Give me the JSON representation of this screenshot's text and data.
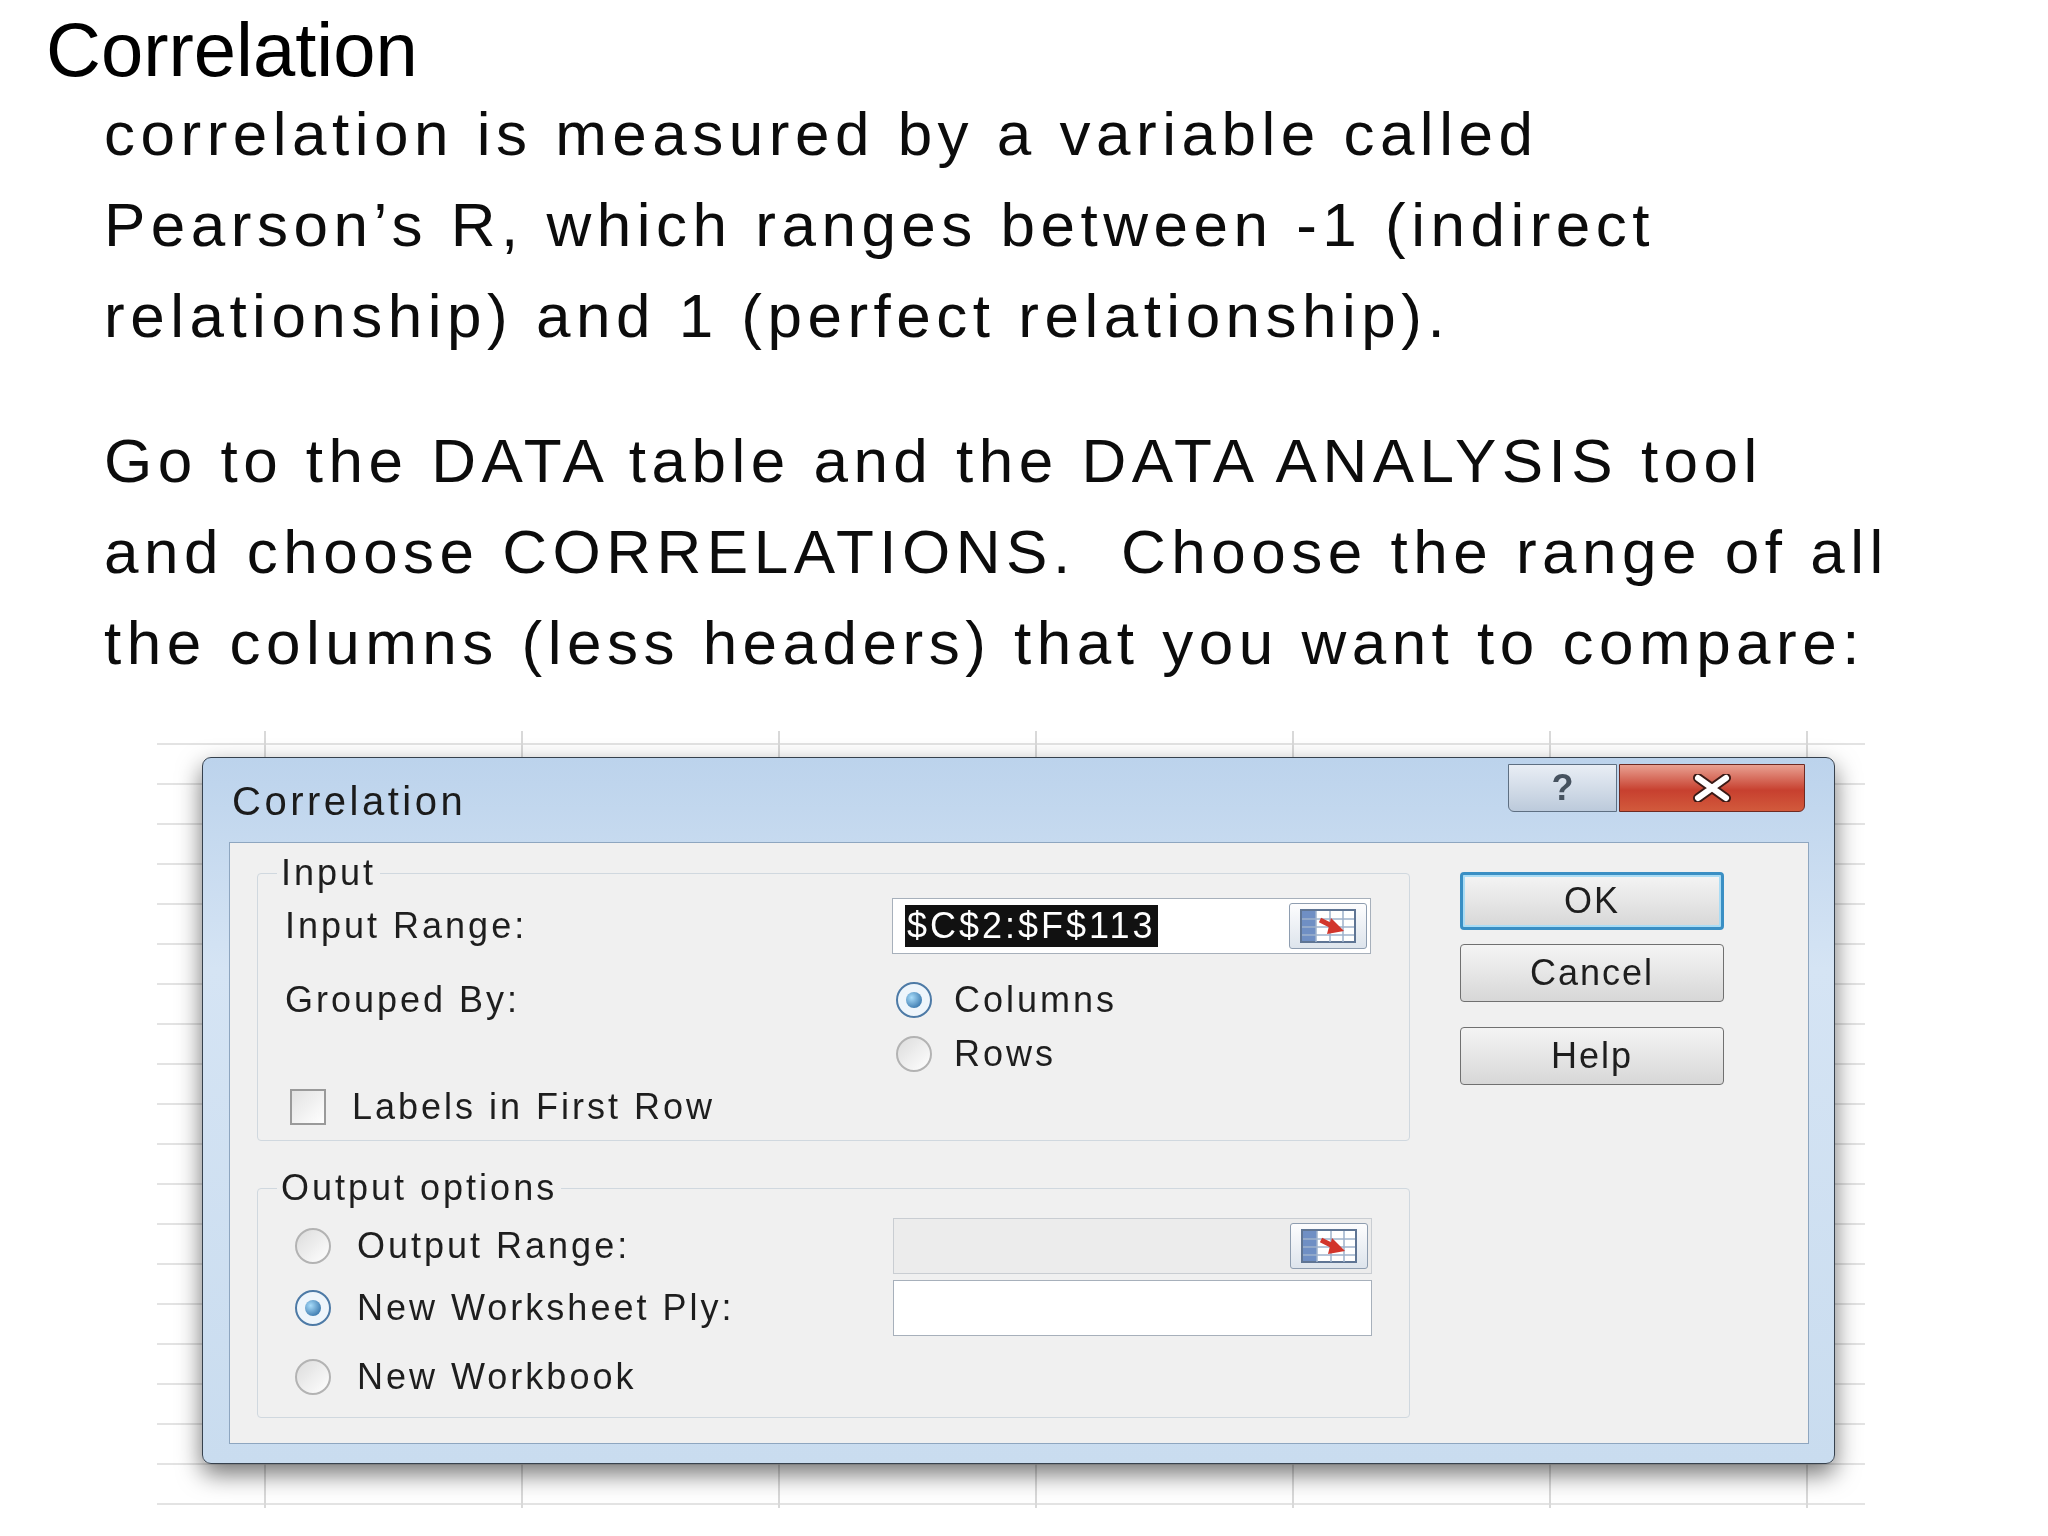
{
  "slide": {
    "title": "Correlation",
    "paragraphs": [
      "correlation is measured by a variable called\nPearson’s R, which ranges between -1 (indirect\nrelationship) and 1 (perfect relationship).",
      "Go to the DATA table and the DATA ANALYSIS tool\nand choose CORRELATIONS.  Choose the range of all\nthe columns (less headers) that you want to compare:"
    ]
  },
  "dialog": {
    "title": "Correlation",
    "caption_buttons": [
      {
        "kind": "help",
        "label": "?"
      },
      {
        "kind": "close"
      }
    ],
    "input": {
      "label": "Input",
      "input_range": {
        "label": "Input Range:",
        "value": "$C$2:$F$113",
        "highlighted": true,
        "picker": true
      },
      "grouped_by": {
        "label": "Grouped By:",
        "options": [
          {
            "label": "Columns",
            "selected": true
          },
          {
            "label": "Rows",
            "selected": false
          }
        ]
      },
      "labels_in_first_row": {
        "label": "Labels in First Row",
        "checked": false
      }
    },
    "output_options": {
      "label": "Output options",
      "options": [
        {
          "label": "Output Range:",
          "selected": false,
          "field": {
            "disabled": true,
            "picker": true
          }
        },
        {
          "label": "New Worksheet Ply:",
          "selected": true,
          "field": {
            "disabled": false,
            "picker": false
          }
        },
        {
          "label": "New Workbook",
          "selected": false
        }
      ]
    },
    "buttons": [
      {
        "label": "OK",
        "default": true
      },
      {
        "label": "Cancel",
        "default": false
      },
      {
        "label": "Help",
        "default": false
      }
    ]
  }
}
